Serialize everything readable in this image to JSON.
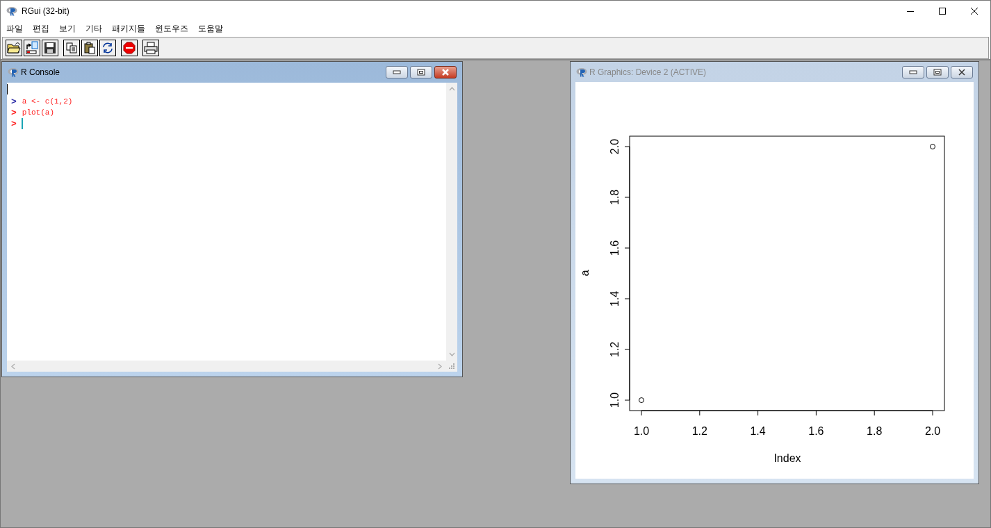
{
  "window": {
    "title": "RGui (32-bit)"
  },
  "menu": [
    "파일",
    "편집",
    "보기",
    "기타",
    "패키지들",
    "윈도우즈",
    "도움말"
  ],
  "toolbar": [
    {
      "kind": "open"
    },
    {
      "kind": "load"
    },
    {
      "kind": "save"
    },
    {
      "kind": "copy"
    },
    {
      "kind": "paste"
    },
    {
      "kind": "refresh"
    },
    {
      "kind": "stop"
    },
    {
      "kind": "print"
    }
  ],
  "console": {
    "title": "R Console",
    "active": true,
    "lines": [
      {
        "prompt": ">",
        "code": "a <- c(1,2)",
        "color": "#3333aa"
      },
      {
        "prompt": ">",
        "code": "plot(a)",
        "color": "#ff2222"
      },
      {
        "prompt": ">",
        "color": "#ff2222"
      }
    ]
  },
  "graphics": {
    "title": "R Graphics: Device 2 (ACTIVE)",
    "active": false,
    "chart_data": {
      "type": "scatter",
      "xlabel": "Index",
      "ylabel": "a",
      "x": [
        1,
        2
      ],
      "values": [
        1,
        2
      ],
      "xlim": [
        1,
        2
      ],
      "ylim": [
        1,
        2
      ],
      "xticks": [
        {
          "value": 1,
          "label": "1.0"
        },
        {
          "value": 1.2,
          "label": "1.2"
        },
        {
          "value": 1.4,
          "label": "1.4"
        },
        {
          "value": 1.6,
          "label": "1.6"
        },
        {
          "value": 1.8,
          "label": "1.8"
        },
        {
          "value": 2,
          "label": "2.0"
        }
      ],
      "yticks": [
        {
          "value": 1,
          "label": "1.0"
        },
        {
          "value": 1.2,
          "label": "1.2"
        },
        {
          "value": 1.4,
          "label": "1.4"
        },
        {
          "value": 1.6,
          "label": "1.6"
        },
        {
          "value": 1.8,
          "label": "1.8"
        },
        {
          "value": 2,
          "label": "2.0"
        }
      ]
    }
  }
}
